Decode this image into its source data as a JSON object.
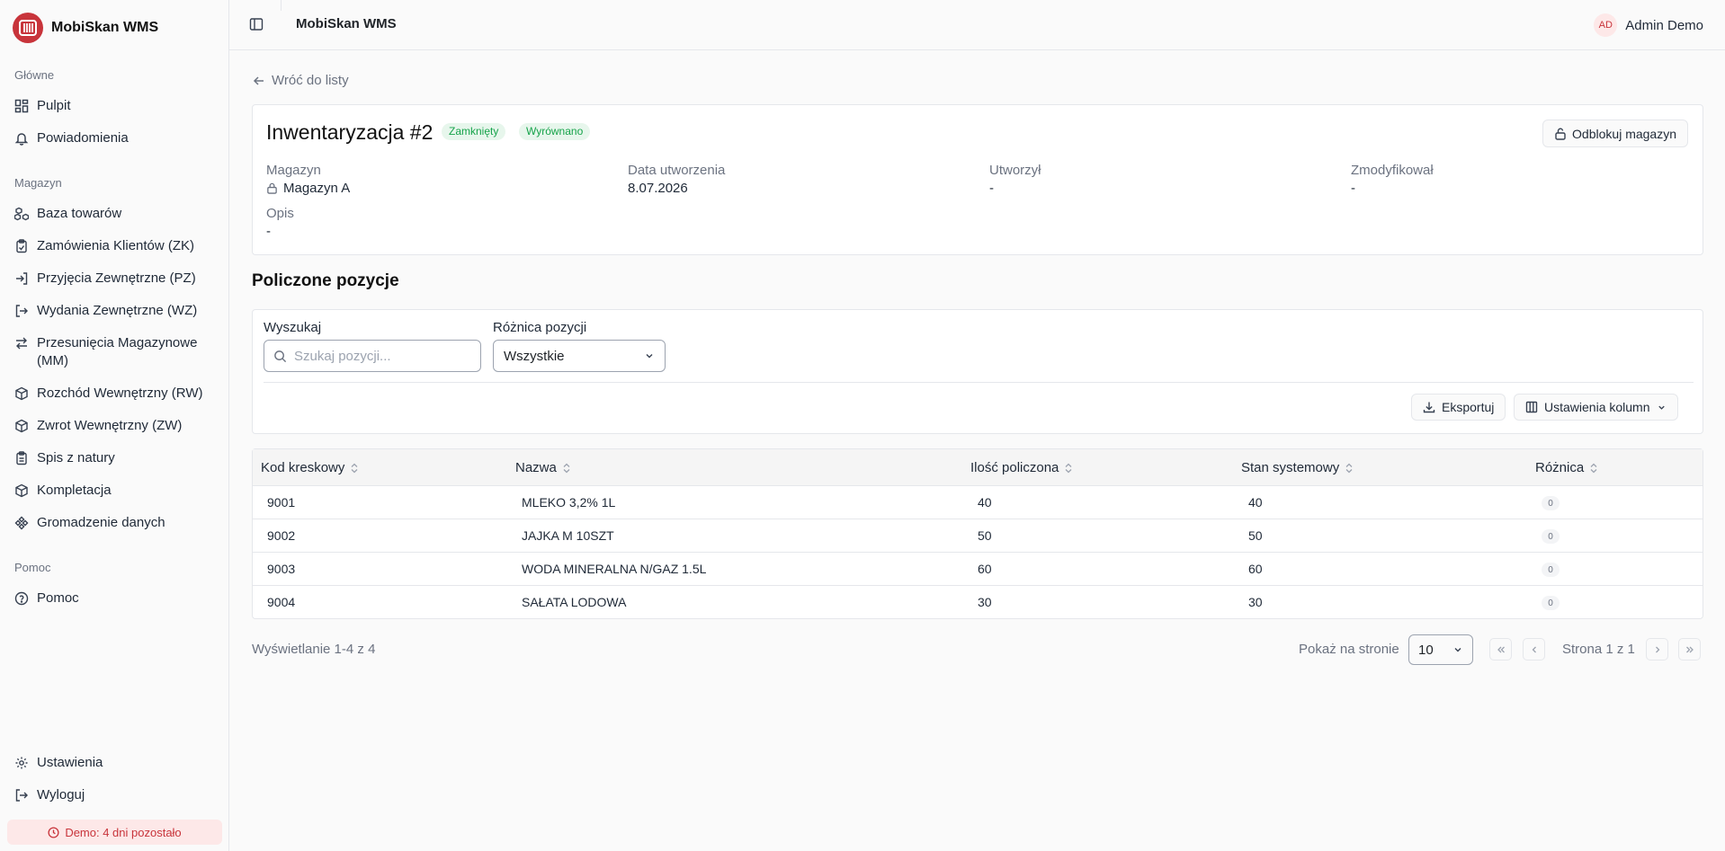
{
  "app": {
    "name": "MobiSkan WMS",
    "header_title": "MobiSkan WMS"
  },
  "user": {
    "initials": "AD",
    "name": "Admin Demo"
  },
  "sidebar": {
    "sections": [
      {
        "label": "Główne",
        "items": [
          {
            "label": "Pulpit",
            "icon": "grid-icon"
          },
          {
            "label": "Powiadomienia",
            "icon": "bell-icon"
          }
        ]
      },
      {
        "label": "Magazyn",
        "items": [
          {
            "label": "Baza towarów",
            "icon": "boxes-icon"
          },
          {
            "label": "Zamówienia Klientów (ZK)",
            "icon": "clipboard-icon"
          },
          {
            "label": "Przyjęcia Zewnętrzne (PZ)",
            "icon": "log-in-icon"
          },
          {
            "label": "Wydania Zewnętrzne (WZ)",
            "icon": "log-out-icon"
          },
          {
            "label": "Przesunięcia Magazynowe (MM)",
            "icon": "arrows-left-right-icon"
          },
          {
            "label": "Rozchód Wewnętrzny (RW)",
            "icon": "package-icon"
          },
          {
            "label": "Zwrot Wewnętrzny (ZW)",
            "icon": "package-icon"
          },
          {
            "label": "Spis z natury",
            "icon": "clipboard-list-icon"
          },
          {
            "label": "Kompletacja",
            "icon": "package-icon"
          },
          {
            "label": "Gromadzenie danych",
            "icon": "workflow-icon"
          }
        ]
      },
      {
        "label": "Pomoc",
        "items": [
          {
            "label": "Pomoc",
            "icon": "help-circle-icon"
          }
        ]
      }
    ],
    "footer_items": [
      {
        "label": "Ustawienia",
        "icon": "gear-icon"
      },
      {
        "label": "Wyloguj",
        "icon": "log-out-icon"
      }
    ],
    "demo_badge": "Demo: 4 dni pozostało"
  },
  "page": {
    "back_label": "Wróć do listy",
    "title": "Inwentaryzacja #2",
    "badges": [
      "Zamknięty",
      "Wyrównano"
    ],
    "unlock_button": "Odblokuj magazyn",
    "meta": {
      "warehouse_label": "Magazyn",
      "warehouse_value": "Magazyn A",
      "created_label": "Data utworzenia",
      "created_value": "8.07.2026",
      "created_by_label": "Utworzył",
      "created_by_value": "-",
      "modified_by_label": "Zmodyfikował",
      "modified_by_value": "-",
      "description_label": "Opis",
      "description_value": "-"
    },
    "section_title": "Policzone pozycje"
  },
  "filters": {
    "search_label": "Wyszukaj",
    "search_placeholder": "Szukaj pozycji...",
    "diff_label": "Różnica pozycji",
    "diff_value": "Wszystkie",
    "export_button": "Eksportuj",
    "columns_button": "Ustawienia kolumn"
  },
  "table": {
    "columns": [
      "Kod kreskowy",
      "Nazwa",
      "Ilość policzona",
      "Stan systemowy",
      "Różnica"
    ],
    "rows": [
      {
        "barcode": "9001",
        "name": "MLEKO 3,2% 1L",
        "counted": "40",
        "system": "40",
        "diff": "0"
      },
      {
        "barcode": "9002",
        "name": "JAJKA M 10SZT",
        "counted": "50",
        "system": "50",
        "diff": "0"
      },
      {
        "barcode": "9003",
        "name": "WODA MINERALNA N/GAZ 1.5L",
        "counted": "60",
        "system": "60",
        "diff": "0"
      },
      {
        "barcode": "9004",
        "name": "SAŁATA LODOWA",
        "counted": "30",
        "system": "30",
        "diff": "0"
      }
    ]
  },
  "pagination": {
    "info": "Wyświetlanie 1-4 z 4",
    "per_page_label": "Pokaż na stronie",
    "per_page_value": "10",
    "page_info": "Strona 1 z 1"
  },
  "colors": {
    "brand": "#c8343b",
    "success": "#16a34a",
    "success_bg": "#e7f6ec",
    "demo_bg": "#fde8e8"
  }
}
